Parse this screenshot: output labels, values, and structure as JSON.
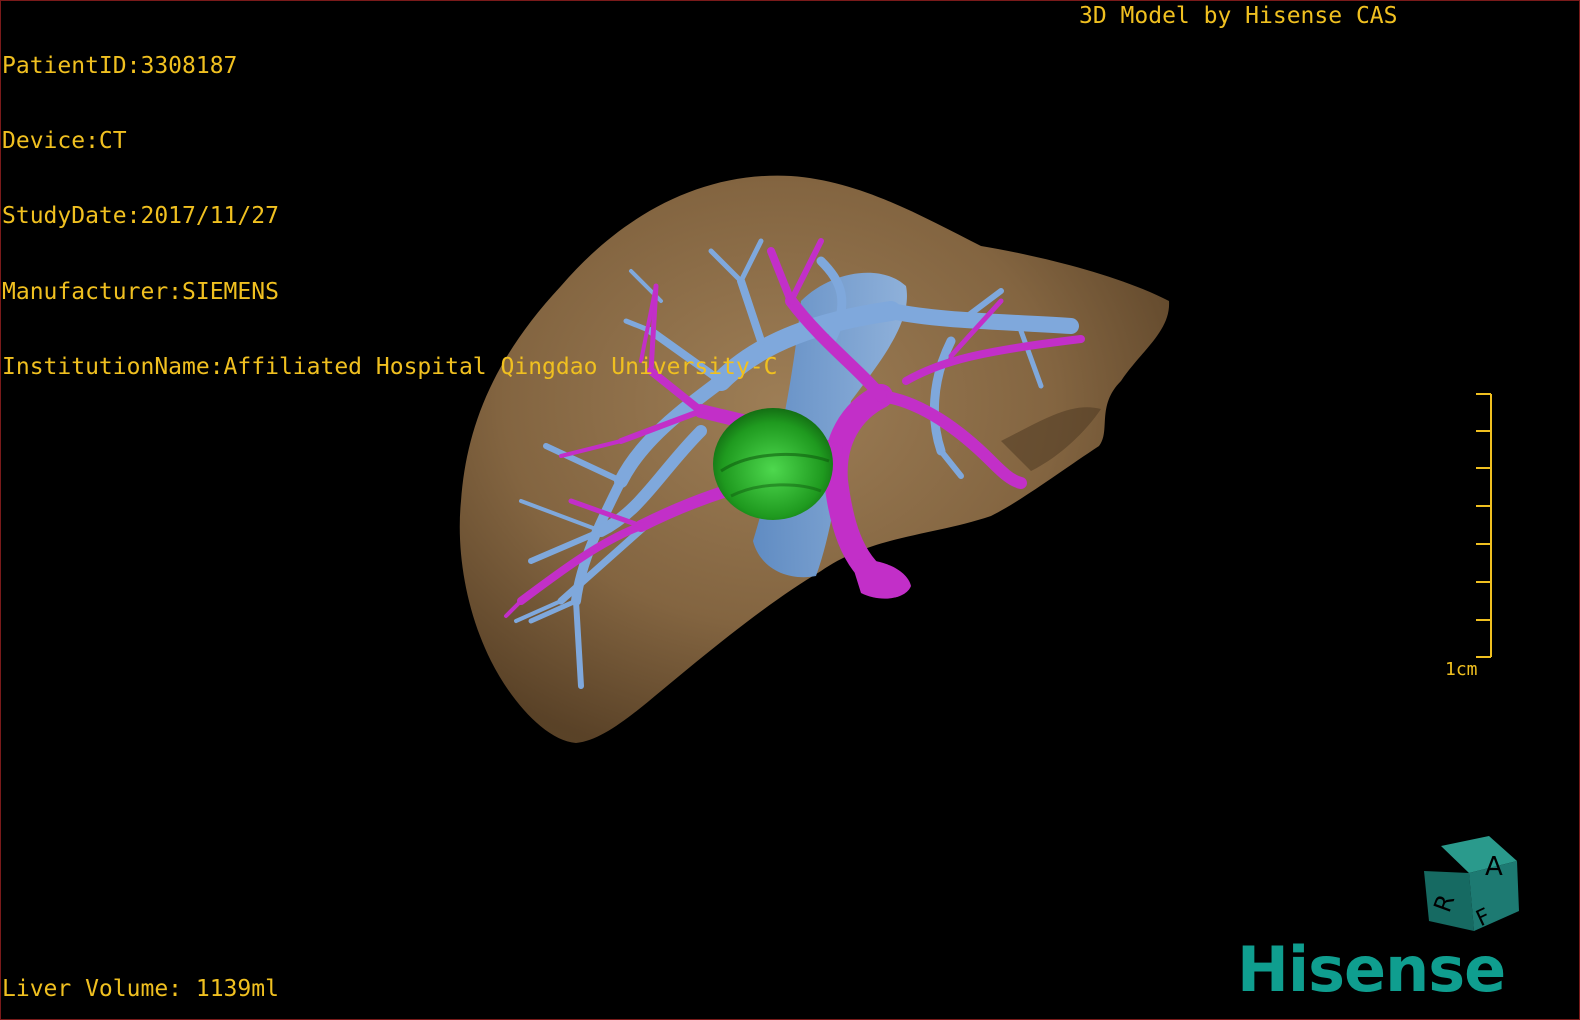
{
  "header": {
    "patient_id": "PatientID:3308187",
    "device": "Device:CT",
    "study_date": "StudyDate:2017/11/27",
    "manufacturer": "Manufacturer:SIEMENS",
    "institution": "InstitutionName:Affiliated Hospital Qingdao University-C",
    "model_credit": "3D Model by Hisense CAS"
  },
  "footer": {
    "liver_volume": "Liver Volume: 1139ml"
  },
  "scale_bar": {
    "label": "1cm"
  },
  "orientation_cube": {
    "face_top": "A",
    "face_left": "R",
    "face_bottom": "F"
  },
  "brand": {
    "logo_text": "Hisense",
    "logo_color": "#0f9e8f"
  },
  "colors": {
    "overlay_text": "#f0c020",
    "liver": "#8a6a44",
    "hepatic_vein": "#7fa8dc",
    "portal_vein": "#c22fc8",
    "tumor": "#2aa82a",
    "cube": "#1d7a72"
  }
}
